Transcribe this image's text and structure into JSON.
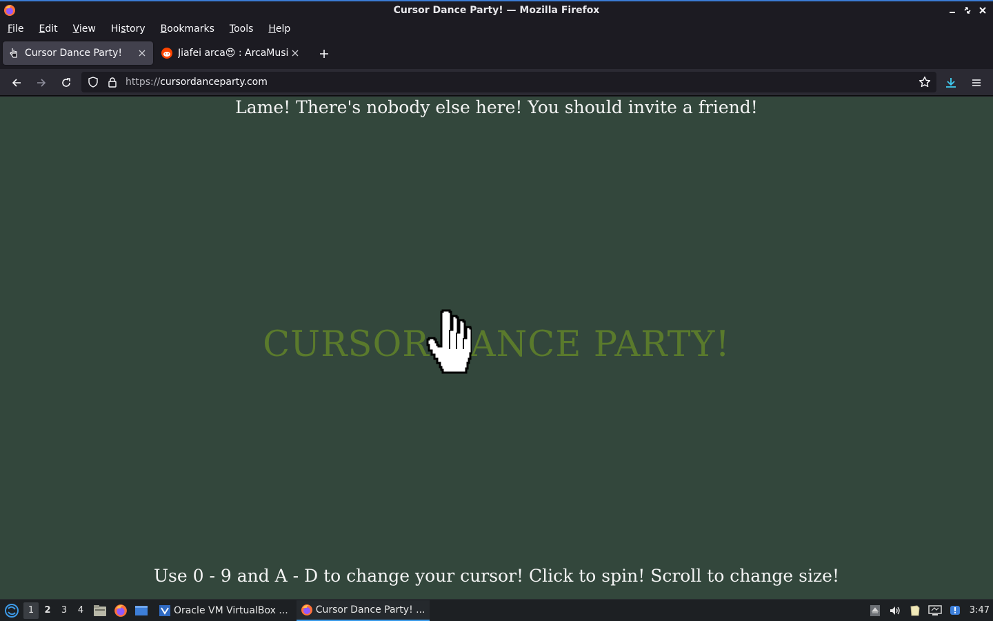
{
  "window": {
    "title": "Cursor Dance Party! — Mozilla Firefox"
  },
  "menubar": {
    "items": [
      {
        "underline": "F",
        "rest": "ile"
      },
      {
        "underline": "E",
        "rest": "dit"
      },
      {
        "underline": "V",
        "rest": "iew"
      },
      {
        "pre": "Hi",
        "underline": "s",
        "rest": "tory"
      },
      {
        "underline": "B",
        "rest": "ookmarks"
      },
      {
        "underline": "T",
        "rest": "ools"
      },
      {
        "underline": "H",
        "rest": "elp"
      }
    ]
  },
  "tabs": [
    {
      "label": "Cursor Dance Party!",
      "active": true
    },
    {
      "label": "Jiafei arca😍 : ArcaMusic",
      "active": false
    }
  ],
  "urlbar": {
    "protocol": "https://",
    "host": "cursordanceparty.com"
  },
  "page": {
    "top_message": "Lame! There's nobody else here! You should invite a friend!",
    "title": "CURSOR DANCE PARTY!",
    "bottom_message": "Use 0 - 9 and A - D to change your cursor! Click to spin! Scroll to change size!",
    "background_color": "#33473c",
    "title_color": "#5a7a2c"
  },
  "taskbar": {
    "workspaces": [
      "1",
      "2",
      "3",
      "4"
    ],
    "current_workspace": "1",
    "tasks": [
      {
        "label": "Oracle VM VirtualBox ...",
        "icon": "virtualbox-icon",
        "active": false
      },
      {
        "label": "Cursor Dance Party! ...",
        "icon": "firefox-icon",
        "active": true
      }
    ],
    "clock": "3:47"
  }
}
